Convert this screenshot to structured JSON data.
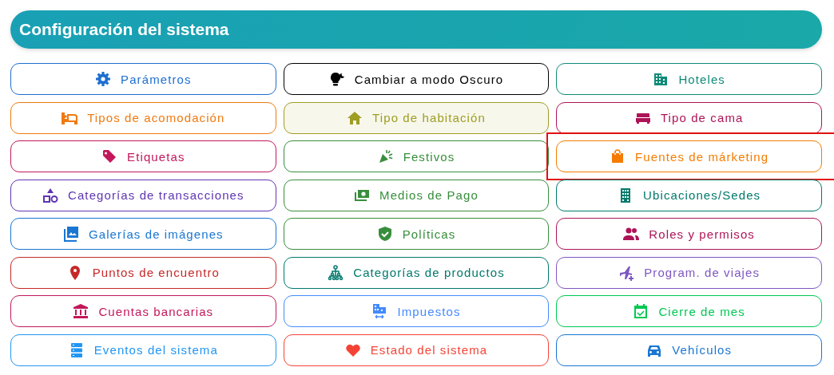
{
  "title": "Configuración del sistema",
  "items": [
    {
      "label": "Parámetros",
      "color": "#1e6fd0",
      "selected": false,
      "highlighted": false
    },
    {
      "label": "Cambiar a modo Oscuro",
      "color": "#000000",
      "selected": false,
      "highlighted": false
    },
    {
      "label": "Hoteles",
      "color": "#0e8a78",
      "selected": false,
      "highlighted": false
    },
    {
      "label": "Tipos de acomodación",
      "color": "#f07a10",
      "selected": false,
      "highlighted": false
    },
    {
      "label": "Tipo de habitación",
      "color": "#9e9d24",
      "selected": true,
      "highlighted": false
    },
    {
      "label": "Tipo de cama",
      "color": "#ad1457",
      "selected": false,
      "highlighted": false
    },
    {
      "label": "Etiquetas",
      "color": "#c2185b",
      "selected": false,
      "highlighted": false
    },
    {
      "label": "Festivos",
      "color": "#388e3c",
      "selected": false,
      "highlighted": false
    },
    {
      "label": "Fuentes de márketing",
      "color": "#f57c00",
      "selected": false,
      "highlighted": true
    },
    {
      "label": "Categorías de transacciones",
      "color": "#5e35b1",
      "selected": false,
      "highlighted": false
    },
    {
      "label": "Medios de Pago",
      "color": "#388e3c",
      "selected": false,
      "highlighted": false
    },
    {
      "label": "Ubicaciones/Sedes",
      "color": "#00796b",
      "selected": false,
      "highlighted": false
    },
    {
      "label": "Galerías de imágenes",
      "color": "#1976d2",
      "selected": false,
      "highlighted": false
    },
    {
      "label": "Políticas",
      "color": "#388e3c",
      "selected": false,
      "highlighted": false
    },
    {
      "label": "Roles y permisos",
      "color": "#ad1457",
      "selected": false,
      "highlighted": false
    },
    {
      "label": "Puntos de encuentro",
      "color": "#c62828",
      "selected": false,
      "highlighted": false
    },
    {
      "label": "Categorías de productos",
      "color": "#00796b",
      "selected": false,
      "highlighted": false
    },
    {
      "label": "Program. de viajes",
      "color": "#7e57c2",
      "selected": false,
      "highlighted": false
    },
    {
      "label": "Cuentas bancarias",
      "color": "#c2185b",
      "selected": false,
      "highlighted": false
    },
    {
      "label": "Impuestos",
      "color": "#448aff",
      "selected": false,
      "highlighted": false
    },
    {
      "label": "Cierre de mes",
      "color": "#00c853",
      "selected": false,
      "highlighted": false
    },
    {
      "label": "Eventos del sistema",
      "color": "#2196f3",
      "selected": false,
      "highlighted": false
    },
    {
      "label": "Estado del sistema",
      "color": "#f44336",
      "selected": false,
      "highlighted": false
    },
    {
      "label": "Vehículos",
      "color": "#1976d2",
      "selected": false,
      "highlighted": false
    }
  ]
}
